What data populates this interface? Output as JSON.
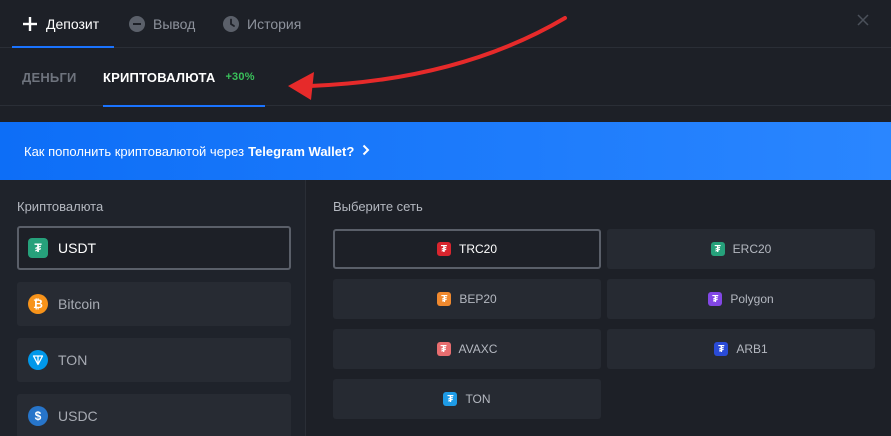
{
  "top_tabs": {
    "deposit": "Депозит",
    "withdraw": "Вывод",
    "history": "История"
  },
  "sub_tabs": {
    "money": "ДЕНЬГИ",
    "crypto": "КРИПТОВАЛЮТА",
    "bonus": "+30%"
  },
  "banner": {
    "text": "Как пополнить криптовалютой через",
    "highlight": "Telegram Wallet?"
  },
  "crypto_panel": {
    "title": "Криптовалюта",
    "coins": [
      "USDT",
      "Bitcoin",
      "TON",
      "USDC"
    ]
  },
  "network_panel": {
    "title": "Выберите сеть",
    "networks": [
      "TRC20",
      "ERC20",
      "BEP20",
      "Polygon",
      "AVAXC",
      "ARB1",
      "TON"
    ]
  },
  "colors": {
    "accent": "#1a73ff",
    "bonus": "#39c15a",
    "arrow": "#e62a2a"
  }
}
